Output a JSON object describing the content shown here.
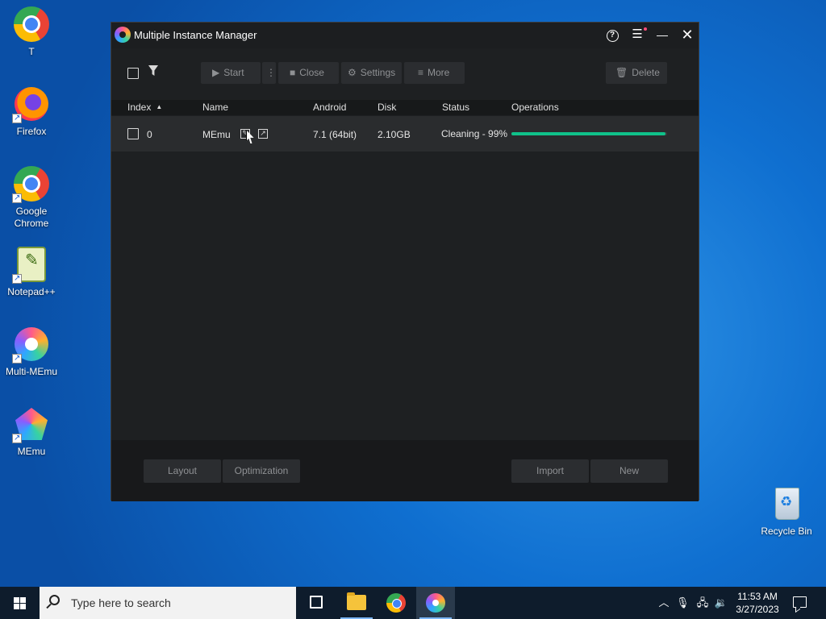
{
  "desktop": {
    "icons": [
      {
        "label": "T"
      },
      {
        "label": "Firefox"
      },
      {
        "label": "Google Chrome"
      },
      {
        "label": "Notepad++"
      },
      {
        "label": "Multi-MEmu"
      },
      {
        "label": "MEmu"
      },
      {
        "label": "Recycle Bin"
      }
    ]
  },
  "window": {
    "title": "Multiple Instance Manager",
    "toolbar": {
      "start": "Start",
      "close": "Close",
      "settings": "Settings",
      "more": "More",
      "delete": "Delete"
    },
    "columns": {
      "index": "Index",
      "name": "Name",
      "android": "Android",
      "disk": "Disk",
      "status": "Status",
      "operations": "Operations"
    },
    "rows": [
      {
        "index": "0",
        "name": "MEmu",
        "android": "7.1 (64bit)",
        "disk": "2.10GB",
        "status": "Cleaning - 99%",
        "progress": 0.99
      }
    ],
    "footer": {
      "layout": "Layout",
      "optimization": "Optimization",
      "import": "Import",
      "new": "New"
    },
    "colors": {
      "progress": "#10c28a",
      "background": "#1e2022"
    }
  },
  "taskbar": {
    "search_placeholder": "Type here to search",
    "time": "11:53 AM",
    "date": "3/27/2023"
  }
}
